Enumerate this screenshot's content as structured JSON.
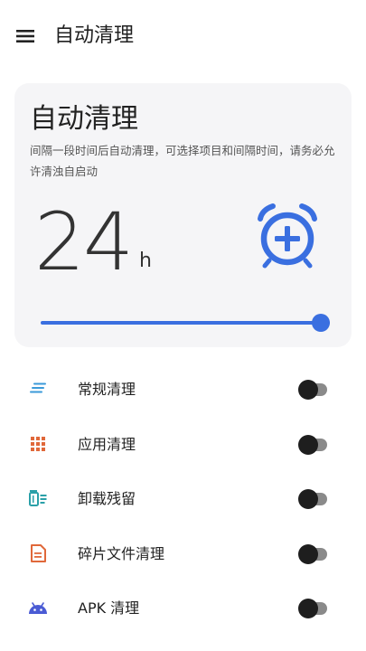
{
  "appbar": {
    "menu_icon": "hamburger-menu-icon",
    "title": "自动清理"
  },
  "card": {
    "title": "自动清理",
    "description": "间隔一段时间后自动清理，可选择项目和间隔时间，请务必允许清浊自启动",
    "interval_value": "24",
    "interval_unit": "h",
    "alarm_icon": "alarm-add-icon",
    "slider_level": 1.0,
    "accent_color": "#3a6fe0"
  },
  "items": [
    {
      "label": "常规清理",
      "icon": "lines-icon",
      "icon_color": "#3b9ad9",
      "enabled": false
    },
    {
      "label": "应用清理",
      "icon": "grid-icon",
      "icon_color": "#e0683a",
      "enabled": false
    },
    {
      "label": "卸载残留",
      "icon": "trash-list-icon",
      "icon_color": "#2aa0a8",
      "enabled": false
    },
    {
      "label": "碎片文件清理",
      "icon": "document-icon",
      "icon_color": "#e0683a",
      "enabled": false
    },
    {
      "label": "APK 清理",
      "icon": "android-icon",
      "icon_color": "#4a5bd4",
      "enabled": false
    }
  ]
}
